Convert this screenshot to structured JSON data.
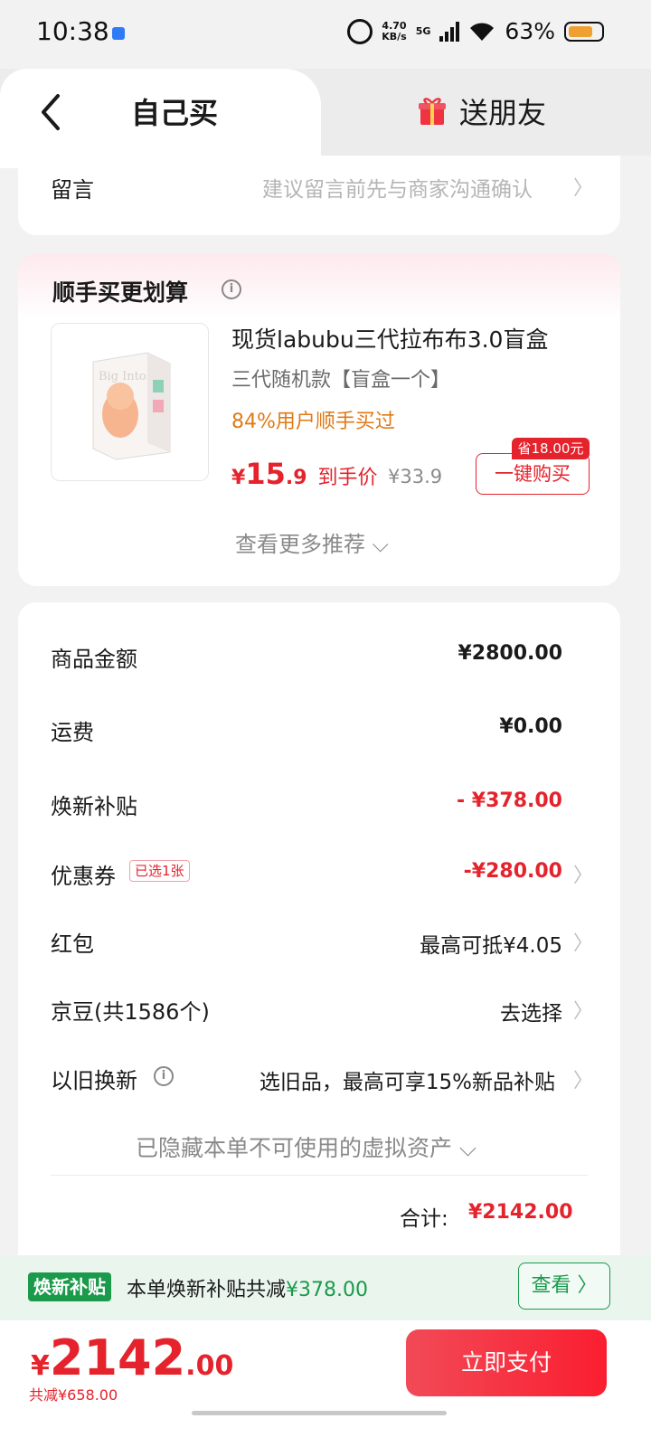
{
  "status_bar": {
    "time": "10:38",
    "net_speed_value": "4.70",
    "net_speed_unit": "KB/s",
    "network": "5G",
    "battery": "63%"
  },
  "tabs": {
    "self_buy": "自己买",
    "send_friend": "送朋友"
  },
  "note": {
    "label": "留言",
    "hint": "建议留言前先与商家沟通确认",
    "chevron": "〉"
  },
  "recommend": {
    "title": "顺手买更划算",
    "product_name": "现货labubu三代拉布布3.0盲盒",
    "spec": "三代随机款【盲盒一个】",
    "bought": "84%用户顺手买过",
    "price_symbol": "¥",
    "price_int": "15",
    "price_dec": ".9",
    "price_tag": "到手价",
    "original_price": "¥33.9",
    "save_badge": "省18.00元",
    "buy_button": "一键购买",
    "more": "查看更多推荐 ⌵"
  },
  "summary": {
    "goods_label": "商品金额",
    "goods_value": "¥2800.00",
    "shipping_label": "运费",
    "shipping_value": "¥0.00",
    "subsidy_label": "焕新补贴",
    "subsidy_value": "- ¥378.00",
    "coupon_label": "优惠券",
    "coupon_tag": "已选1张",
    "coupon_value": "-¥280.00",
    "redpacket_label": "红包",
    "redpacket_value": "最高可抵¥4.05",
    "jingdou_label": "京豆(共1586个)",
    "jingdou_value": "去选择",
    "tradein_label": "以旧换新",
    "tradein_value": "选旧品，最高可享15%新品补贴",
    "hidden_assets": "已隐藏本单不可使用的虚拟资产 ⌵",
    "total_label": "合计:",
    "total_value": "¥2142.00",
    "chevron": "〉"
  },
  "subsidy_banner": {
    "tag": "焕新补贴",
    "text": "本单焕新补贴共减",
    "amount": "¥378.00",
    "view_button": "查看 〉"
  },
  "pay": {
    "symbol": "¥",
    "amount_int": "2142",
    "amount_dec": ".00",
    "saved": "共减¥658.00",
    "button": "立即支付"
  },
  "colors": {
    "accent_red": "#e4232d",
    "subsidy_green": "#1b9a4b",
    "bought_orange": "#e07a17"
  }
}
